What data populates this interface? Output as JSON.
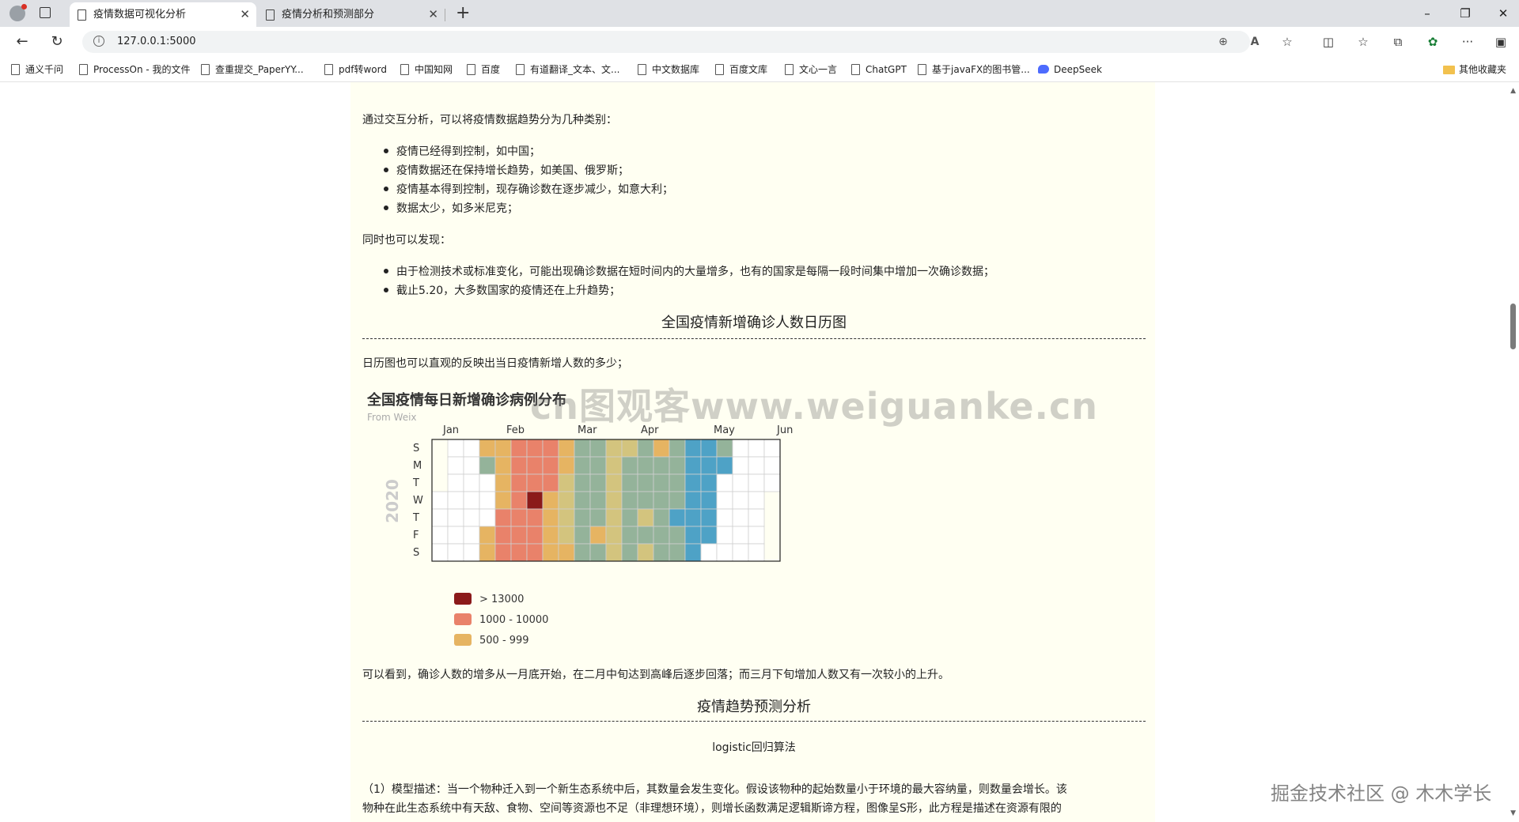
{
  "browser": {
    "tabs": [
      {
        "title": "疫情数据可视化分析",
        "active": true
      },
      {
        "title": "疫情分析和预测部分",
        "active": false
      }
    ],
    "url": "127.0.0.1:5000",
    "window_controls": {
      "minimize": "–",
      "restore": "❐",
      "close": "✕"
    },
    "icons": {
      "back": "←",
      "reload": "↻",
      "new_tab": "+",
      "zoom": "⊕",
      "read_aloud": "A",
      "favorite": "☆",
      "split": "◫",
      "favorites": "☆",
      "collections": "⧉",
      "extensions": "✿",
      "more": "···",
      "sidebar": "▣",
      "info": "i"
    },
    "bookmarks": [
      "通义千问",
      "ProcessOn - 我的文件",
      "查重提交_PaperYY...",
      "pdf转word",
      "中国知网",
      "百度",
      "有道翻译_文本、文...",
      "中文数据库",
      "百度文库",
      "文心一言",
      "ChatGPT",
      "基于javaFX的图书管...",
      "DeepSeek"
    ],
    "other_bookmarks": "其他收藏夹"
  },
  "content": {
    "intro": "通过交互分析，可以将疫情数据趋势分为几种类别：",
    "categories": [
      "疫情已经得到控制，如中国；",
      "疫情数据还在保持增长趋势，如美国、俄罗斯；",
      "疫情基本得到控制，现存确诊数在逐步减少，如意大利；",
      "数据太少，如多米尼克；"
    ],
    "also": "同时也可以发现：",
    "findings": [
      "由于检测技术或标准变化，可能出现确诊数据在短时间内的大量增多，也有的国家是每隔一段时间集中增加一次确诊数据；",
      "截止5.20，大多数国家的疫情还在上升趋势；"
    ],
    "section1_title": "全国疫情新增确诊人数日历图",
    "calendar_desc": "日历图也可以直观的反映出当日疫情新增人数的多少；",
    "calendar_conclusion": "可以看到，确诊人数的增多从一月底开始，在二月中旬达到高峰后逐步回落；而三月下旬增加人数又有一次较小的上升。",
    "section2_title": "疫情趋势预测分析",
    "method_title": "logistic回归算法",
    "model_desc_line1": "（1）模型描述：当一个物种迁入到一个新生态系统中后，其数量会发生变化。假设该物种的起始数量小于环境的最大容纳量，则数量会增长。该",
    "model_desc_line2": "物种在此生态系统中有天敌、食物、空间等资源也不足（非理想环境），则增长函数满足逻辑斯谛方程，图像呈S形，此方程是描述在资源有限的"
  },
  "chart_data": {
    "type": "heatmap",
    "title": "全国疫情每日新增确诊病例分布",
    "subtitle": "From Weix",
    "year_label": "2020",
    "month_labels": [
      "Jan",
      "Feb",
      "Mar",
      "Apr",
      "May",
      "Jun"
    ],
    "day_labels": [
      "S",
      "M",
      "T",
      "W",
      "T",
      "F",
      "S"
    ],
    "legend": [
      {
        "label": "> 13000",
        "color": "#8b1a1a"
      },
      {
        "label": "1000 - 10000",
        "color": "#e9826a"
      },
      {
        "label": "500 - 999",
        "color": "#e6b462"
      }
    ],
    "bins": [
      {
        "key": "peak",
        "color": "#8b1a1a"
      },
      {
        "key": "high",
        "color": "#e9826a"
      },
      {
        "key": "mid",
        "color": "#e6b462"
      },
      {
        "key": "low",
        "color": "#d3c47e"
      },
      {
        "key": "lower",
        "color": "#94b39a"
      },
      {
        "key": "lowest",
        "color": "#4ea2c6"
      },
      {
        "key": "none",
        "color": "#ffffff"
      }
    ],
    "start_date": "2020-01-01",
    "end_date": "2020-06-02",
    "weekly_levels": [
      [
        "",
        "",
        "",
        "none",
        "none",
        "none",
        "none"
      ],
      [
        "none",
        "none",
        "none",
        "none",
        "none",
        "none",
        "none"
      ],
      [
        "none",
        "none",
        "none",
        "none",
        "none",
        "none",
        "none"
      ],
      [
        "mid",
        "lower",
        "none",
        "none",
        "none",
        "mid",
        "mid"
      ],
      [
        "mid",
        "mid",
        "mid",
        "mid",
        "high",
        "high",
        "high"
      ],
      [
        "high",
        "high",
        "high",
        "high",
        "high",
        "high",
        "high"
      ],
      [
        "high",
        "high",
        "high",
        "peak",
        "high",
        "high",
        "high"
      ],
      [
        "high",
        "high",
        "high",
        "mid",
        "mid",
        "mid",
        "mid"
      ],
      [
        "mid",
        "mid",
        "low",
        "low",
        "low",
        "low",
        "mid"
      ],
      [
        "lower",
        "lower",
        "lower",
        "lower",
        "lower",
        "lower",
        "lower"
      ],
      [
        "lower",
        "lower",
        "lower",
        "lower",
        "lower",
        "mid",
        "lower"
      ],
      [
        "low",
        "low",
        "low",
        "low",
        "low",
        "low",
        "low"
      ],
      [
        "low",
        "lower",
        "lower",
        "lower",
        "lower",
        "lower",
        "lower"
      ],
      [
        "lower",
        "lower",
        "lower",
        "lower",
        "low",
        "lower",
        "low"
      ],
      [
        "mid",
        "lower",
        "lower",
        "lower",
        "lower",
        "lower",
        "lower"
      ],
      [
        "lower",
        "lower",
        "lower",
        "lower",
        "lowest",
        "lower",
        "lower"
      ],
      [
        "lowest",
        "lowest",
        "lowest",
        "lowest",
        "lowest",
        "lowest",
        "lowest"
      ],
      [
        "lowest",
        "lowest",
        "lowest",
        "lowest",
        "lowest",
        "lowest",
        "none"
      ],
      [
        "lower",
        "lowest",
        "none",
        "none",
        "none",
        "none",
        "none"
      ],
      [
        "none",
        "none",
        "none",
        "none",
        "none",
        "none",
        "none"
      ],
      [
        "none",
        "none",
        "none",
        "none",
        "none",
        "none",
        "none"
      ],
      [
        "none",
        "none",
        "none",
        "",
        "",
        "",
        ""
      ]
    ]
  },
  "watermarks": {
    "center": "cn图观客www.weiguanke.cn",
    "corner": "掘金技术社区 @ 木木学长"
  }
}
